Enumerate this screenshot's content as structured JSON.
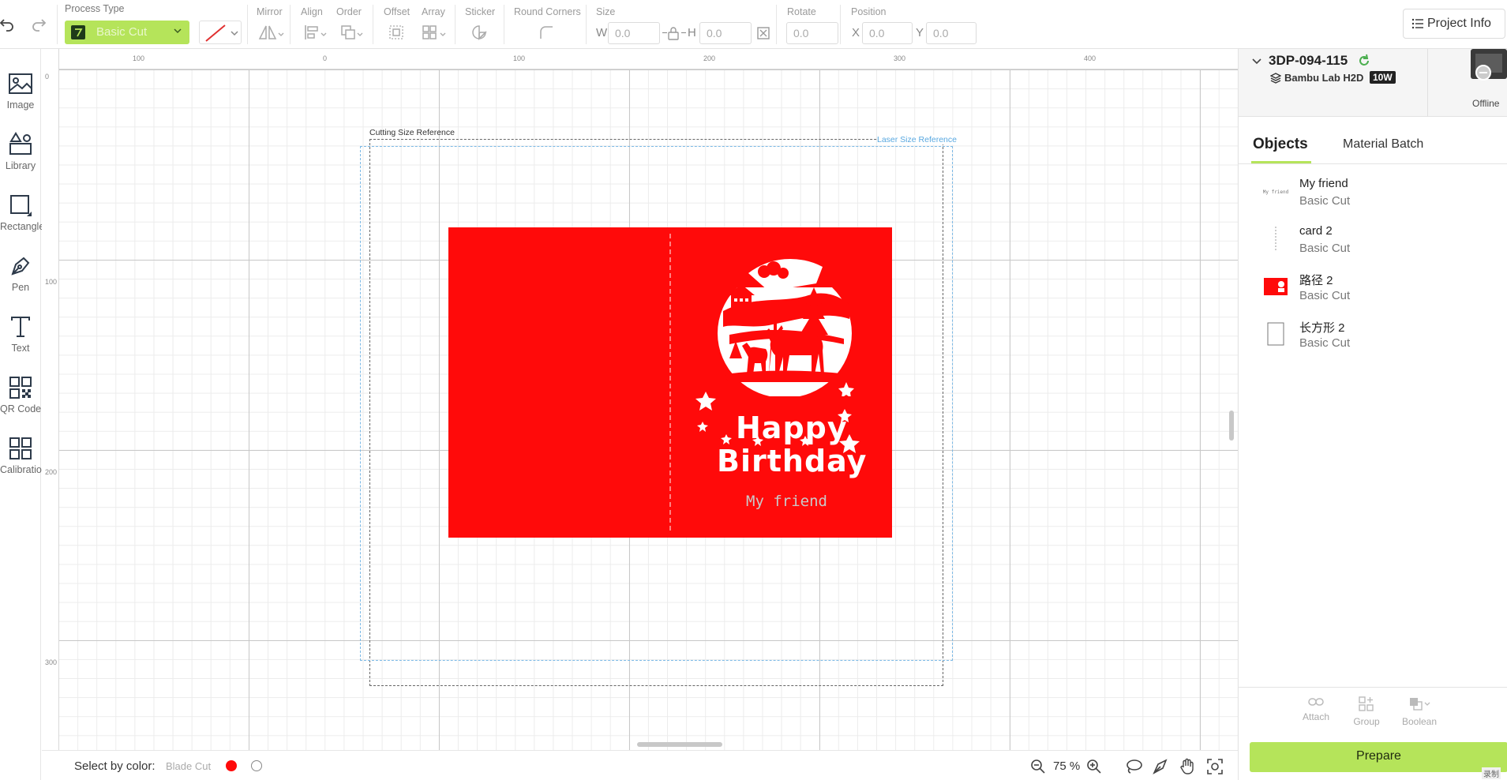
{
  "toolbar": {
    "process_type_label": "Process Type",
    "process_type_value": "Basic Cut",
    "mirror_label": "Mirror",
    "align_label": "Align",
    "order_label": "Order",
    "offset_label": "Offset",
    "array_label": "Array",
    "sticker_label": "Sticker",
    "round_corners_label": "Round Corners",
    "size_label": "Size",
    "w_label": "W",
    "w_value": "0.0",
    "h_label": "H",
    "h_value": "0.0",
    "rotate_label": "Rotate",
    "rotate_value": "0.0",
    "position_label": "Position",
    "x_label": "X",
    "x_value": "0.0",
    "y_label": "Y",
    "y_value": "0.0",
    "project_info_label": "Project Info"
  },
  "left_tools": [
    {
      "label": "Image",
      "icon": "image-icon"
    },
    {
      "label": "Library",
      "icon": "library-icon"
    },
    {
      "label": "Rectangle",
      "icon": "rectangle-icon"
    },
    {
      "label": "Pen",
      "icon": "pen-icon"
    },
    {
      "label": "Text",
      "icon": "text-icon"
    },
    {
      "label": "QR Code",
      "icon": "qr-code-icon"
    },
    {
      "label": "Calibration",
      "icon": "calibration-icon"
    }
  ],
  "canvas": {
    "ruler_top_labels": [
      "100",
      "0",
      "100",
      "200",
      "300",
      "400"
    ],
    "ruler_left_labels": [
      "0",
      "100",
      "200",
      "300"
    ],
    "cutting_ref_label": "Cutting Size Reference",
    "laser_ref_label": "Laser Size Reference",
    "card": {
      "happy_text": "Happy",
      "birthday_text": "Birthday",
      "friend_text": "My friend"
    }
  },
  "device": {
    "name": "3DP-094-115",
    "model": "Bambu Lab H2D",
    "power_badge": "10W",
    "status": "Offline"
  },
  "right_tabs": [
    {
      "label": "Objects",
      "active": true
    },
    {
      "label": "Material Batch",
      "active": false
    }
  ],
  "objects": [
    {
      "name": "My friend",
      "type": "Basic Cut",
      "thumb": "text-thumb",
      "thumb_text": "My friend"
    },
    {
      "name": "card 2",
      "type": "Basic Cut",
      "thumb": "dashed-line-thumb"
    },
    {
      "name": "路径 2",
      "type": "Basic Cut",
      "thumb": "red-card-thumb"
    },
    {
      "name": "长方形 2",
      "type": "Basic Cut",
      "thumb": "rectangle-thumb"
    }
  ],
  "bottom_actions": {
    "attach_label": "Attach",
    "group_label": "Group",
    "boolean_label": "Boolean",
    "prepare_label": "Prepare",
    "corner_text": "录制"
  },
  "statusbar": {
    "select_by_color_label": "Select by color:",
    "blade_cut_label": "Blade Cut",
    "zoom_value": "75 %"
  },
  "colors": {
    "accent_green": "#b5e45a",
    "card_red": "#ff0a0a",
    "laser_blue": "#59a8e0"
  }
}
